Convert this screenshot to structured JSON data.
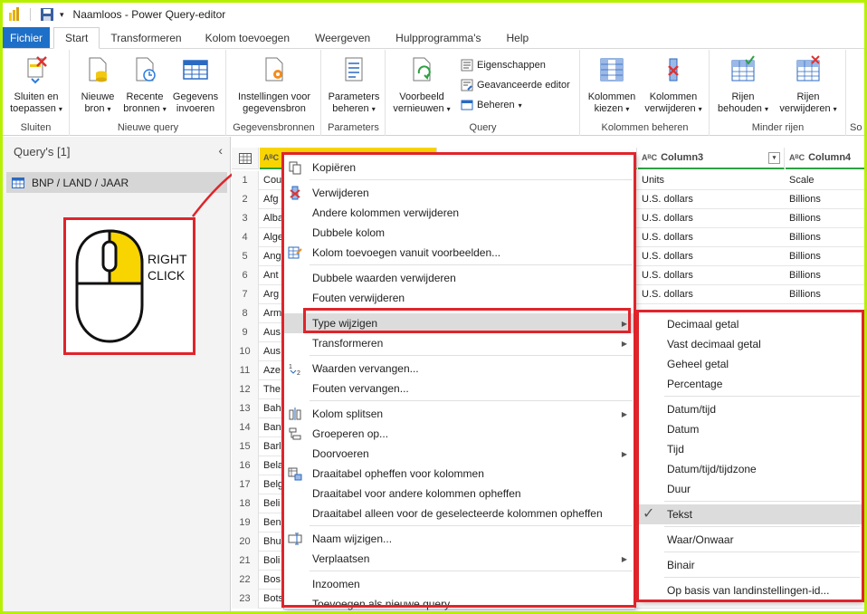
{
  "window": {
    "title": "Naamloos - Power Query-editor"
  },
  "tabs": [
    {
      "label": "Fichier"
    },
    {
      "label": "Start"
    },
    {
      "label": "Transformeren"
    },
    {
      "label": "Kolom toevoegen"
    },
    {
      "label": "Weergeven"
    },
    {
      "label": "Hulpprogramma's"
    },
    {
      "label": "Help"
    }
  ],
  "ribbon": {
    "groups": {
      "sluiten": "Sluiten",
      "nieuwe_query": "Nieuwe query",
      "gegevensbronnen": "Gegevensbronnen",
      "parameters": "Parameters",
      "query": "Query",
      "kolommen_beheren": "Kolommen beheren",
      "minder_rijen": "Minder rijen",
      "so": "So"
    },
    "buttons": {
      "sluiten_1": "Sluiten en",
      "sluiten_2": "toepassen",
      "nieuwe_bron_1": "Nieuwe",
      "nieuwe_bron_2": "bron",
      "recente_1": "Recente",
      "recente_2": "bronnen",
      "gegevens_1": "Gegevens",
      "gegevens_2": "invoeren",
      "instellingen_1": "Instellingen voor",
      "instellingen_2": "gegevensbron",
      "parameters_1": "Parameters",
      "parameters_2": "beheren",
      "voorbeeld_1": "Voorbeeld",
      "voorbeeld_2": "vernieuwen",
      "eigenschappen": "Eigenschappen",
      "geavanceerde": "Geavanceerde editor",
      "beheren": "Beheren",
      "kolommen_kiezen_1": "Kolommen",
      "kolommen_kiezen_2": "kiezen",
      "kolommen_verw_1": "Kolommen",
      "kolommen_verw_2": "verwijderen",
      "rijen_beh_1": "Rijen",
      "rijen_beh_2": "behouden",
      "rijen_verw_1": "Rijen",
      "rijen_verw_2": "verwijderen"
    }
  },
  "left_panel": {
    "header": "Query's [1]",
    "query_name": "BNP / LAND / JAAR"
  },
  "callout": {
    "line1": "RIGHT",
    "line2": "CLICK"
  },
  "grid": {
    "headers": {
      "col1_prefix": "C",
      "col3": "Column3",
      "col4": "Column4"
    },
    "rows": [
      {
        "n": "1",
        "c1": "Cou",
        "c3": "Units",
        "c4": "Scale"
      },
      {
        "n": "2",
        "c1": "Afg",
        "c3": "U.S. dollars",
        "c4": "Billions"
      },
      {
        "n": "3",
        "c1": "Alba",
        "c3": "U.S. dollars",
        "c4": "Billions"
      },
      {
        "n": "4",
        "c1": "Alge",
        "c3": "U.S. dollars",
        "c4": "Billions"
      },
      {
        "n": "5",
        "c1": "Ang",
        "c3": "U.S. dollars",
        "c4": "Billions"
      },
      {
        "n": "6",
        "c1": "Ant",
        "c3": "U.S. dollars",
        "c4": "Billions"
      },
      {
        "n": "7",
        "c1": "Arg",
        "c3": "U.S. dollars",
        "c4": "Billions"
      },
      {
        "n": "8",
        "c1": "Arm",
        "c3": "",
        "c4": ""
      },
      {
        "n": "9",
        "c1": "Aus",
        "c3": "",
        "c4": ""
      },
      {
        "n": "10",
        "c1": "Aus",
        "c3": "",
        "c4": ""
      },
      {
        "n": "11",
        "c1": "Aze",
        "c3": "",
        "c4": ""
      },
      {
        "n": "12",
        "c1": "The",
        "c3": "",
        "c4": ""
      },
      {
        "n": "13",
        "c1": "Bah",
        "c3": "",
        "c4": ""
      },
      {
        "n": "14",
        "c1": "Ban",
        "c3": "",
        "c4": ""
      },
      {
        "n": "15",
        "c1": "Barl",
        "c3": "",
        "c4": ""
      },
      {
        "n": "16",
        "c1": "Bela",
        "c3": "",
        "c4": ""
      },
      {
        "n": "17",
        "c1": "Belg",
        "c3": "",
        "c4": ""
      },
      {
        "n": "18",
        "c1": "Beli",
        "c3": "",
        "c4": ""
      },
      {
        "n": "19",
        "c1": "Ben",
        "c3": "",
        "c4": ""
      },
      {
        "n": "20",
        "c1": "Bhu",
        "c3": "",
        "c4": ""
      },
      {
        "n": "21",
        "c1": "Boli",
        "c3": "",
        "c4": ""
      },
      {
        "n": "22",
        "c1": "Bos",
        "c3": "",
        "c4": ""
      },
      {
        "n": "23",
        "c1": "Bots",
        "c3": "",
        "c4": ""
      }
    ]
  },
  "context_menu": {
    "items": [
      "Kopiëren",
      "Verwijderen",
      "Andere kolommen verwijderen",
      "Dubbele kolom",
      "Kolom toevoegen vanuit voorbeelden...",
      "Dubbele waarden verwijderen",
      "Fouten verwijderen",
      "Type wijzigen",
      "Transformeren",
      "Waarden vervangen...",
      "Fouten vervangen...",
      "Kolom splitsen",
      "Groeperen op...",
      "Doorvoeren",
      "Draaitabel opheffen voor kolommen",
      "Draaitabel voor andere kolommen opheffen",
      "Draaitabel alleen voor de geselecteerde kolommen opheffen",
      "Naam wijzigen...",
      "Verplaatsen",
      "Inzoomen",
      "Toevoegen als nieuwe query"
    ]
  },
  "type_menu": {
    "items": [
      "Decimaal getal",
      "Vast decimaal getal",
      "Geheel getal",
      "Percentage",
      "Datum/tijd",
      "Datum",
      "Tijd",
      "Datum/tijd/tijdzone",
      "Duur",
      "Tekst",
      "Waar/Onwaar",
      "Binair",
      "Op basis van landinstellingen-id..."
    ],
    "checked": "Tekst"
  },
  "colors": {
    "accent": "#1e6fc8",
    "highlight_red": "#e0242b",
    "border_green": "#b6f000",
    "column_underline": "#2ea043"
  }
}
